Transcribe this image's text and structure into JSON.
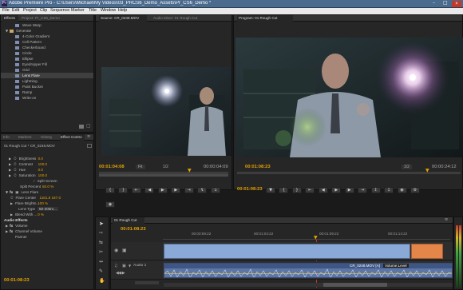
{
  "app": {
    "title": "Adobe Premiere Pro - C:\\Users\\Michael\\My Videos\\03_PRCS6_Demo_Assets\\Pr_CS6_Demo *"
  },
  "menu": [
    "File",
    "Edit",
    "Project",
    "Clip",
    "Sequence",
    "Marker",
    "Title",
    "Window",
    "Help"
  ],
  "effects_panel": {
    "tabs": [
      "Effects",
      "Project: Pr_CS6_Demo"
    ],
    "items": [
      {
        "label": "Wave Warp",
        "kind": "effect"
      },
      {
        "label": "Generate",
        "kind": "folder"
      },
      {
        "label": "4-Color Gradient",
        "kind": "effect"
      },
      {
        "label": "Cell Pattern",
        "kind": "effect"
      },
      {
        "label": "Checkerboard",
        "kind": "effect"
      },
      {
        "label": "Circle",
        "kind": "effect"
      },
      {
        "label": "Ellipse",
        "kind": "effect"
      },
      {
        "label": "Eyedropper Fill",
        "kind": "effect"
      },
      {
        "label": "Grid",
        "kind": "effect"
      },
      {
        "label": "Lens Flare",
        "kind": "effect"
      },
      {
        "label": "Lightning",
        "kind": "effect"
      },
      {
        "label": "Paint Bucket",
        "kind": "effect"
      },
      {
        "label": "Ramp",
        "kind": "effect"
      },
      {
        "label": "Write-on",
        "kind": "effect"
      }
    ]
  },
  "effect_controls": {
    "tabs": [
      "Info",
      "Markers",
      "History",
      "Effect Contro"
    ],
    "clip_label": "01 Rough Cut * CR_0248.MOV",
    "rows": [
      {
        "name": "Brightness",
        "value": "0.0"
      },
      {
        "name": "Contrast",
        "value": "100.0"
      },
      {
        "name": "Hue",
        "value": "0.0"
      },
      {
        "name": "Saturation",
        "value": "100.0"
      }
    ],
    "split_screen": "Split Screen",
    "split_percent": {
      "name": "Split Percent",
      "value": "50.0 %"
    },
    "fx_name": "Lens Flare",
    "lens_rows": [
      {
        "name": "Flare Center",
        "value": "1181.8   187.0"
      },
      {
        "name": "Flare Brightn...",
        "value": "100 %"
      },
      {
        "name": "Lens Type",
        "value": "50-300m..."
      },
      {
        "name": "Blend With ...",
        "value": "0 %"
      }
    ],
    "audio_header": "Audio Effects",
    "audio_rows": [
      "Volume",
      "Channel Volume",
      "Panner"
    ],
    "timecode": "00:01:08:23"
  },
  "source_monitor": {
    "tabs": [
      "Source: CR_0248.MOV",
      "Audio Mixer: 01 Rough Cut"
    ],
    "timecode": "00:01:04:08",
    "fit": "Fit",
    "duration": "00:00:04:09",
    "scale": "1/2"
  },
  "program_monitor": {
    "tab": "Program: 01 Rough Cut",
    "timecode": "00:01:08:23",
    "fit": "Fit",
    "scale": "1/2",
    "duration": "00:00:24:12"
  },
  "timeline": {
    "tab": "01 Rough Cut",
    "timecode": "00:01:08:23",
    "ruler": [
      "00:00:59:22",
      "00:01:04:22",
      "00:01:09:22",
      "00:01:14:22"
    ],
    "audio_track": "Audio 1",
    "clip_label": "CR_0248.MOV [A]",
    "clip_effect": "Volume:Level"
  },
  "colors": {
    "accent": "#e3a200",
    "titlebar": "#4a6a8e",
    "video_clip": "#8aa9d6",
    "selected_clip": "#e4864a"
  }
}
